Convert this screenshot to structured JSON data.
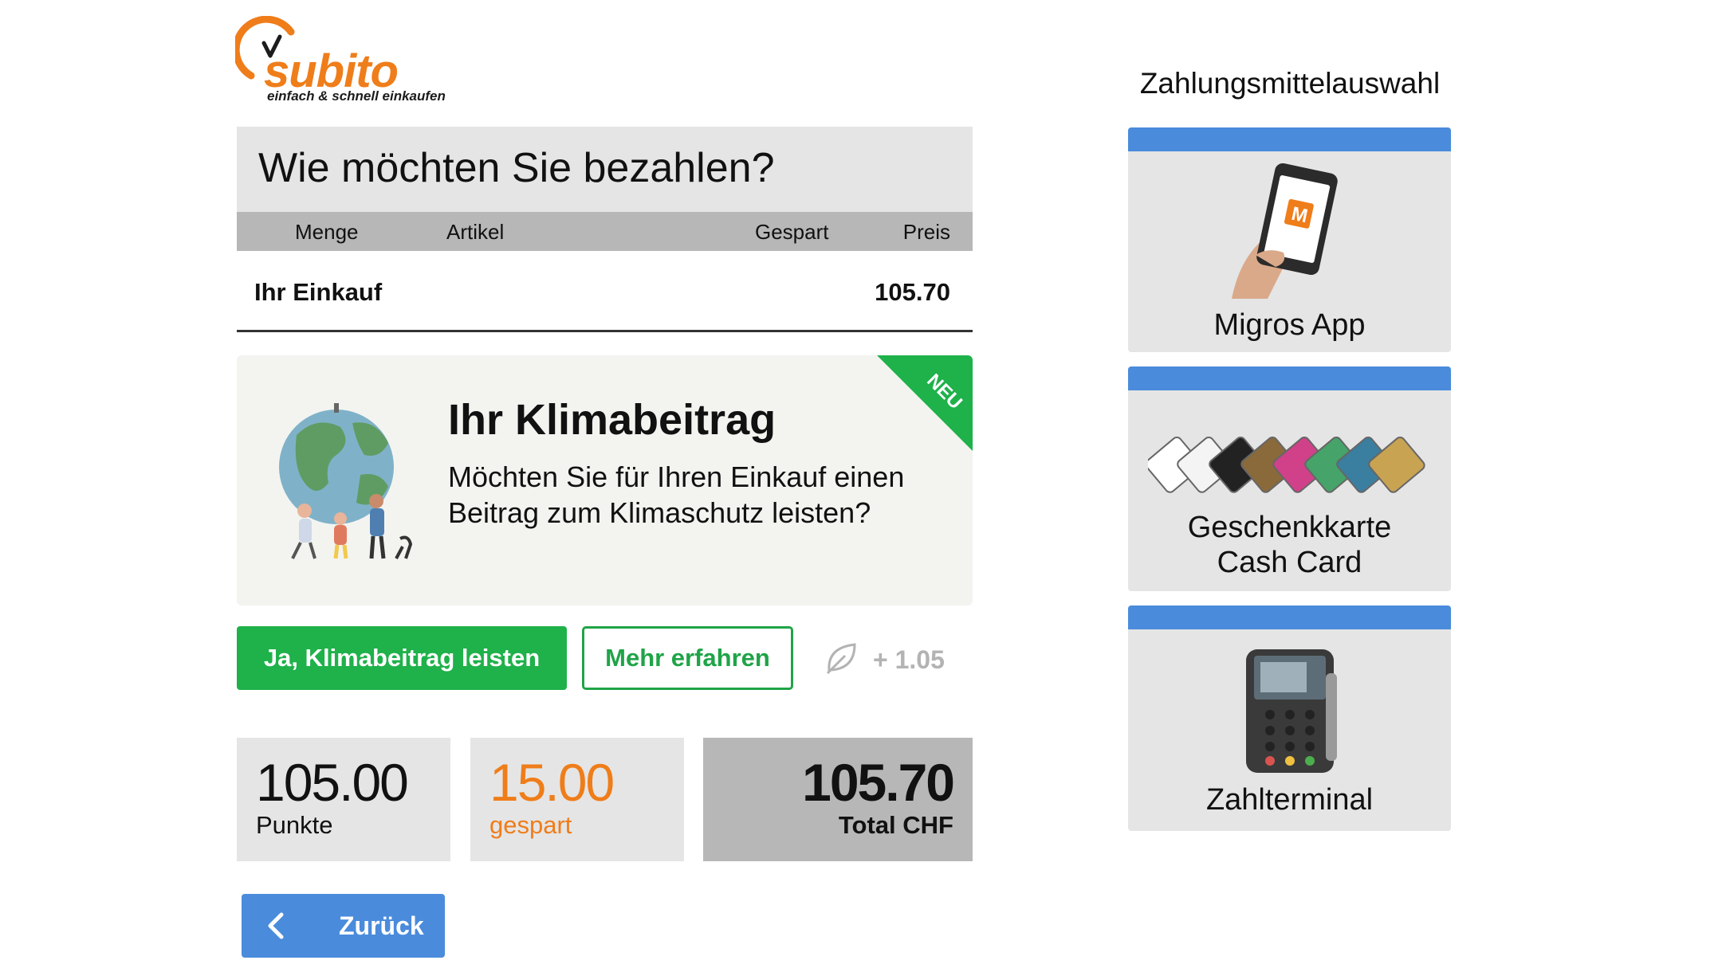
{
  "logo": {
    "brand": "subito",
    "tagline": "einfach & schnell einkaufen"
  },
  "page_title": "Wie möchten Sie bezahlen?",
  "table": {
    "headers": {
      "qty": "Menge",
      "item": "Artikel",
      "saved": "Gespart",
      "price": "Preis"
    },
    "row": {
      "label": "Ihr Einkauf",
      "price": "105.70"
    }
  },
  "climate": {
    "badge": "NEU",
    "title": "Ihr Klimabeitrag",
    "text": "Möchten Sie für Ihren Einkauf einen Beitrag zum Klimaschutz leisten?"
  },
  "actions": {
    "accept_label": "Ja, Klimabeitrag leisten",
    "more_label": "Mehr erfahren",
    "amount": "+ 1.05"
  },
  "summary": {
    "points_value": "105.00",
    "points_label": "Punkte",
    "saved_value": "15.00",
    "saved_label": "gespart",
    "total_value": "105.70",
    "total_label": "Total CHF"
  },
  "back_label": "Zurück",
  "payment": {
    "heading": "Zahlungsmittelauswahl",
    "options": [
      {
        "label": "Migros App"
      },
      {
        "line1": "Geschenkkarte",
        "line2": "Cash Card"
      },
      {
        "label": "Zahlterminal"
      }
    ]
  },
  "colors": {
    "brand_orange": "#ef7d1a",
    "green": "#1fb14a",
    "blue": "#4a8bdc",
    "grey": "#e5e5e5",
    "dark_grey": "#b7b7b7"
  }
}
